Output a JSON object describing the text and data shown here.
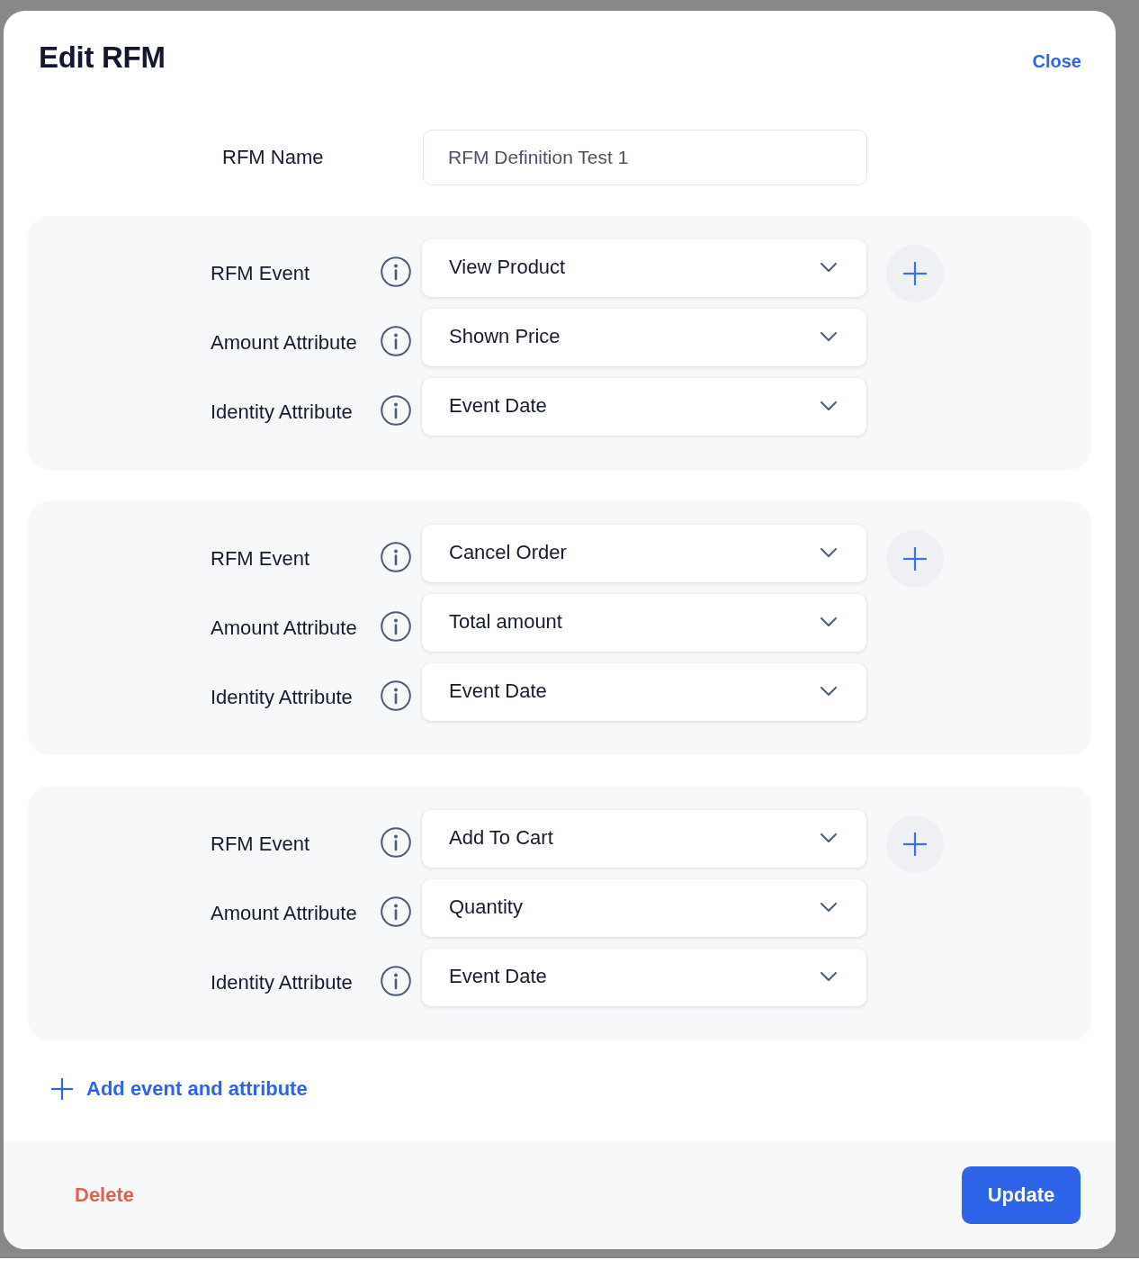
{
  "dialog": {
    "title": "Edit RFM",
    "close_label": "Close"
  },
  "name_field": {
    "label": "RFM Name",
    "value": "RFM Definition Test 1"
  },
  "event_groups": [
    {
      "fields": [
        {
          "label": "RFM Event",
          "value": "View Product"
        },
        {
          "label": "Amount Attribute",
          "value": "Shown Price"
        },
        {
          "label": "Identity Attribute",
          "value": "Event Date"
        }
      ]
    },
    {
      "fields": [
        {
          "label": "RFM Event",
          "value": "Cancel Order"
        },
        {
          "label": "Amount Attribute",
          "value": "Total amount"
        },
        {
          "label": "Identity Attribute",
          "value": "Event Date"
        }
      ]
    },
    {
      "fields": [
        {
          "label": "RFM Event",
          "value": "Add To Cart"
        },
        {
          "label": "Amount Attribute",
          "value": "Quantity"
        },
        {
          "label": "Identity Attribute",
          "value": "Event Date"
        }
      ]
    }
  ],
  "add_link": "Add event and attribute",
  "footer": {
    "delete_label": "Delete",
    "update_label": "Update"
  }
}
